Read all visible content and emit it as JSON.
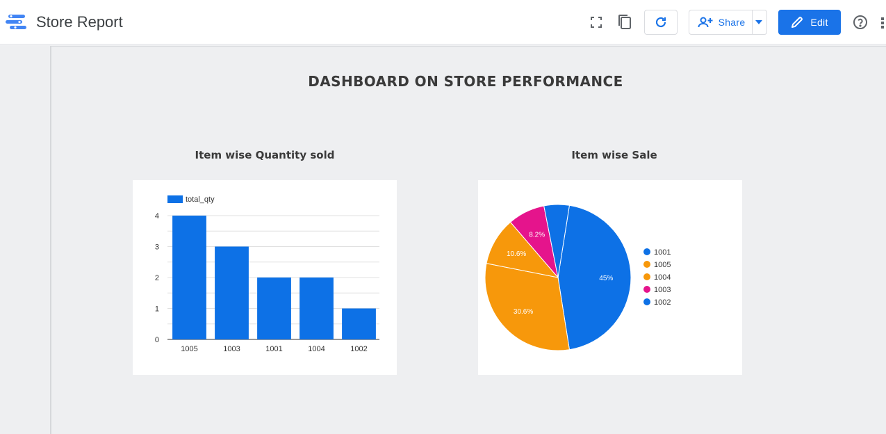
{
  "header": {
    "app_title": "Store Report",
    "share_label": "Share",
    "edit_label": "Edit",
    "icons": [
      "report-logo-icon",
      "fullscreen-icon",
      "copy-icon",
      "refresh-icon",
      "add-person-icon",
      "caret-down-icon",
      "pencil-icon",
      "help-icon",
      "apps-grid-icon"
    ],
    "accent_color": "#1a73e8"
  },
  "report": {
    "title": "DASHBOARD ON STORE PERFORMANCE"
  },
  "chart_data": [
    {
      "type": "bar",
      "title": "Item wise Quantity sold",
      "categories": [
        "1005",
        "1003",
        "1001",
        "1004",
        "1002"
      ],
      "series": [
        {
          "name": "total_qty",
          "values": [
            4,
            3,
            2,
            2,
            1
          ],
          "color": "#0d71e6"
        }
      ],
      "y_ticks": [
        "0",
        "1",
        "2",
        "3",
        "4"
      ],
      "ylim": [
        0,
        4
      ],
      "grid": true,
      "legend_position": "top-left"
    },
    {
      "type": "pie",
      "title": "Item wise Sale",
      "slices": [
        {
          "label": "1001",
          "value": 45,
          "value_label": "45%",
          "color": "#0d71e6"
        },
        {
          "label": "1005",
          "value": 30.6,
          "value_label": "30.6%",
          "color": "#f7980b"
        },
        {
          "label": "1004",
          "value": 10.6,
          "value_label": "10.6%",
          "color": "#f7980b"
        },
        {
          "label": "1003",
          "value": 8.2,
          "value_label": "8.2%",
          "color": "#e5148c"
        },
        {
          "label": "1002",
          "value": 5.6,
          "value_label": "",
          "color": "#0d71e6"
        }
      ],
      "legend": [
        "1001",
        "1005",
        "1004",
        "1003",
        "1002"
      ],
      "legend_position": "right"
    }
  ]
}
